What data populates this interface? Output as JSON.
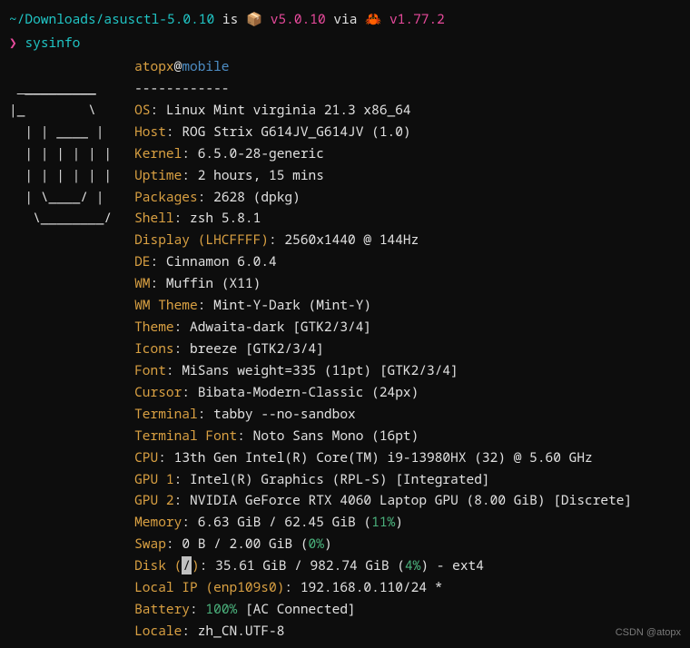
{
  "prompt": {
    "cwd": "~/Downloads/asusctl-5.0.10",
    "is": "is",
    "pkg_icon": "📦",
    "pkg_version": "v5.0.10",
    "via": "via",
    "rust_icon": "🦀",
    "rust_version": "v1.77.2",
    "prompt_char": "❯",
    "command": "sysinfo"
  },
  "header": {
    "user": "atopx",
    "at": "@",
    "host": "mobile",
    "separator": "------------"
  },
  "ascii": [
    " _________",
    "|_        \\",
    "  | | ____ |",
    "  | | | | | |",
    "  | | | | | |",
    "  | \\____/ |",
    "   \\________/"
  ],
  "rows": [
    {
      "key": "OS",
      "val": "Linux Mint virginia 21.3 x86_64"
    },
    {
      "key": "Host",
      "val": "ROG Strix G614JV_G614JV (1.0)"
    },
    {
      "key": "Kernel",
      "val": "6.5.0-28-generic"
    },
    {
      "key": "Uptime",
      "val": "2 hours, 15 mins"
    },
    {
      "key": "Packages",
      "val": "2628 (dpkg)"
    },
    {
      "key": "Shell",
      "val": "zsh 5.8.1"
    },
    {
      "key": "Display (LHCFFFF)",
      "val": "2560x1440 @ 144Hz"
    },
    {
      "key": "DE",
      "val": "Cinnamon 6.0.4"
    },
    {
      "key": "WM",
      "val": "Muffin (X11)"
    },
    {
      "key": "WM Theme",
      "val": "Mint-Y-Dark (Mint-Y)"
    },
    {
      "key": "Theme",
      "val": "Adwaita-dark [GTK2/3/4]"
    },
    {
      "key": "Icons",
      "val": "breeze [GTK2/3/4]"
    },
    {
      "key": "Font",
      "val": "MiSans weight=335 (11pt) [GTK2/3/4]"
    },
    {
      "key": "Cursor",
      "val": "Bibata-Modern-Classic (24px)"
    },
    {
      "key": "Terminal",
      "val": "tabby --no-sandbox"
    },
    {
      "key": "Terminal Font",
      "val": "Noto Sans Mono (16pt)"
    },
    {
      "key": "CPU",
      "val": "13th Gen Intel(R) Core(TM) i9-13980HX (32) @ 5.60 GHz"
    },
    {
      "key": "GPU 1",
      "val": "Intel(R) Graphics (RPL-S) [Integrated]"
    },
    {
      "key": "GPU 2",
      "val": "NVIDIA GeForce RTX 4060 Laptop GPU (8.00 GiB) [Discrete]"
    }
  ],
  "memory": {
    "key": "Memory",
    "pre": "6.63 GiB / 62.45 GiB (",
    "pct": "11%",
    "post": ")"
  },
  "swap": {
    "key": "Swap",
    "pre": "0 B / 2.00 GiB (",
    "pct": "0%",
    "post": ")"
  },
  "disk": {
    "key_pre": "Disk (",
    "key_mount": "/",
    "key_post": ")",
    "pre": "35.61 GiB / 982.74 GiB (",
    "pct": "4%",
    "post": ") - ext4"
  },
  "localip": {
    "key": "Local IP (enp109s0)",
    "val": "192.168.0.110/24 *"
  },
  "battery": {
    "key": "Battery",
    "pct": "100%",
    "post": " [AC Connected]"
  },
  "locale": {
    "key": "Locale",
    "val": "zh_CN.UTF-8"
  },
  "watermark": "CSDN @atopx"
}
